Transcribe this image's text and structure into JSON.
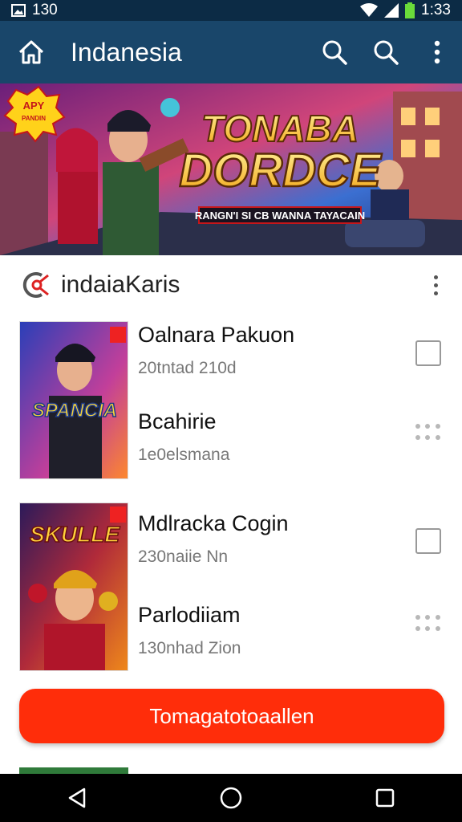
{
  "status_bar": {
    "time_left": "130",
    "time_right": "1:33"
  },
  "app_bar": {
    "title": "Indanesia"
  },
  "banner": {
    "badge": "APY\nPANDIN",
    "headline_1": "TONABA",
    "headline_2": "DORDCE",
    "tagline": "RANGN'I SI CB WANNA TAYACAIN"
  },
  "section": {
    "label": "indaiaKaris"
  },
  "games": [
    {
      "thumb_text": "SPANCIA",
      "items": [
        {
          "title": "Oalnara Pakuon",
          "subtitle": "20tntad 210d",
          "control": "checkbox"
        },
        {
          "title": "Bcahirie",
          "subtitle": "1e0elsmana",
          "control": "drag"
        }
      ]
    },
    {
      "thumb_text": "SKULLE",
      "items": [
        {
          "title": "Mdlracka Cogin",
          "subtitle": "230naiie Nn",
          "control": "checkbox"
        },
        {
          "title": "Parlodiiam",
          "subtitle": "130nhad Zion",
          "control": "drag"
        }
      ]
    }
  ],
  "cta": {
    "label": "Tomagatotoaallen"
  },
  "colors": {
    "app_bar": "#19466a",
    "status_bar": "#0c2b45",
    "cta": "#ff2d0a"
  }
}
